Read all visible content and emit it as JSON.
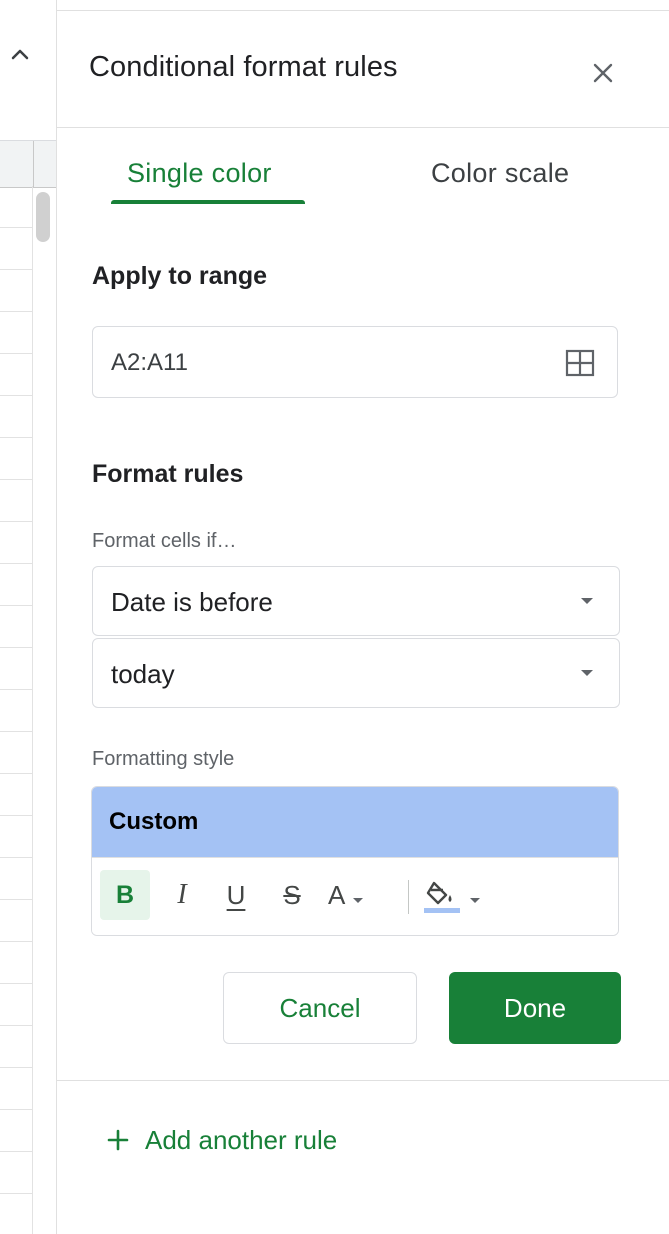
{
  "panel": {
    "title": "Conditional format rules",
    "tabs": [
      {
        "label": "Single color",
        "active": true
      },
      {
        "label": "Color scale",
        "active": false
      }
    ],
    "apply_to_range": {
      "heading": "Apply to range",
      "value": "A2:A11"
    },
    "format_rules": {
      "heading": "Format rules",
      "condition_label": "Format cells if…",
      "condition_value": "Date is before",
      "date_value": "today"
    },
    "formatting_style": {
      "label": "Formatting style",
      "preview_text": "Custom",
      "preview_color": "#a4c2f4",
      "toolbar": {
        "bold": "B",
        "italic": "I",
        "underline": "U",
        "strikethrough": "S",
        "text_color": "A",
        "bold_active": true
      }
    },
    "buttons": {
      "cancel": "Cancel",
      "done": "Done"
    },
    "add_rule": "Add another rule"
  },
  "colors": {
    "accent": "#188038",
    "border": "#dadce0",
    "preview": "#a4c2f4"
  },
  "icons": {
    "close": "close-icon",
    "range": "grid-icon",
    "collapse": "chevron-up-icon",
    "fill": "fill-color-icon",
    "add": "plus-icon"
  }
}
